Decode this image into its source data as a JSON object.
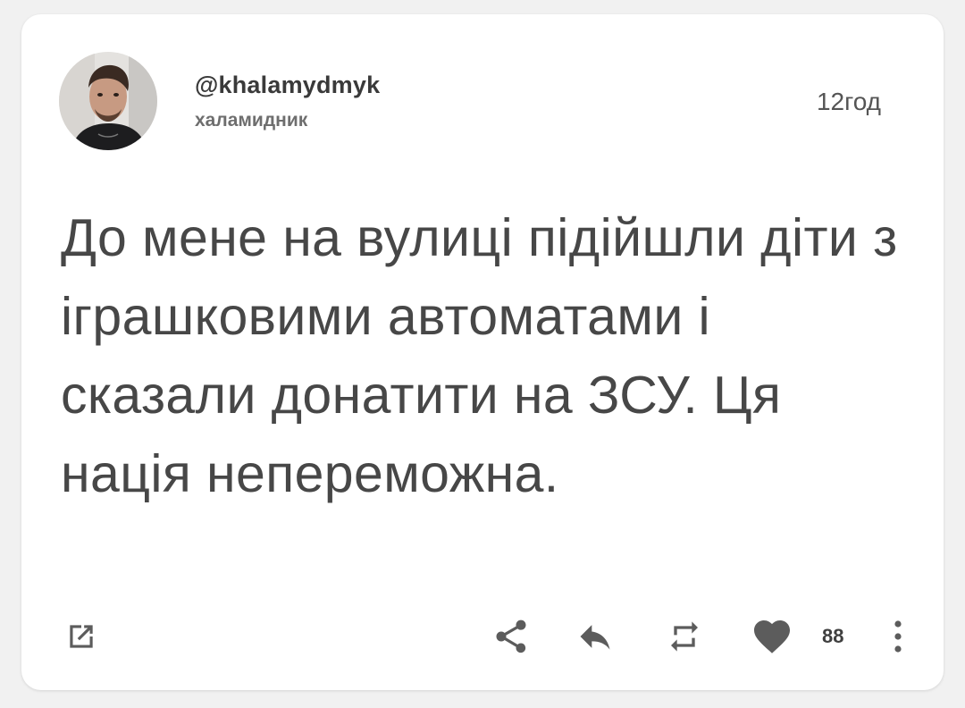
{
  "post": {
    "handle": "@khalamydmyk",
    "display_name": "халамидник",
    "timestamp": "12год",
    "text": "До мене на вулиці підійшли діти з іграшковими автоматами і сказали донатити на ЗСУ. Ця нація непереможна.",
    "like_count": "88"
  },
  "icons": {
    "open": "open-external-icon",
    "share": "share-icon",
    "reply": "reply-icon",
    "repost": "repost-icon",
    "like": "heart-icon",
    "more": "more-vertical-icon"
  },
  "colors": {
    "icon": "#5c5c5c",
    "text": "#474747",
    "background": "#ffffff"
  }
}
